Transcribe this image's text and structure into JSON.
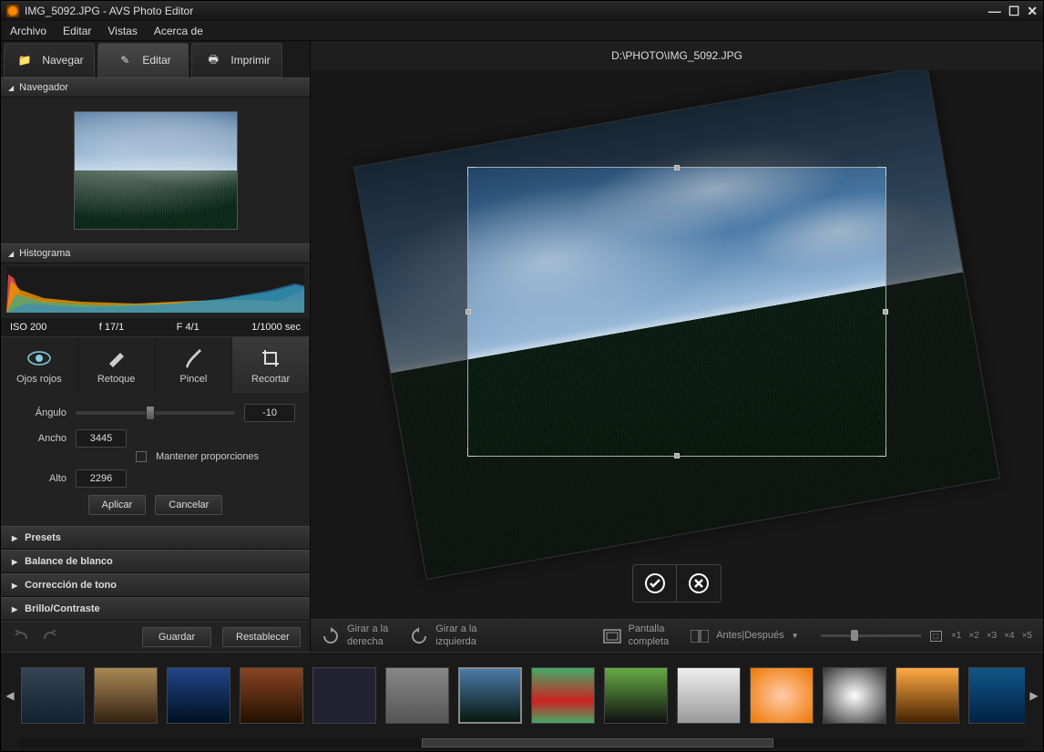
{
  "window": {
    "title": "IMG_5092.JPG  -  AVS Photo Editor"
  },
  "menubar": {
    "file": "Archivo",
    "edit": "Editar",
    "views": "Vistas",
    "about": "Acerca de"
  },
  "tabs": {
    "browse": "Navegar",
    "edit": "Editar",
    "print": "Imprimir"
  },
  "panels": {
    "navigator": "Navegador",
    "histogram": "Histograma"
  },
  "exif": {
    "iso": "ISO 200",
    "focal": "f 17/1",
    "aperture": "F 4/1",
    "shutter": "1/1000 sec"
  },
  "tools": {
    "redeye": "Ojos rojos",
    "retouch": "Retoque",
    "brush": "Pincel",
    "crop": "Recortar"
  },
  "crop": {
    "angle_label": "Ángulo",
    "angle_value": "-10",
    "width_label": "Ancho",
    "width_value": "3445",
    "height_label": "Alto",
    "height_value": "2296",
    "keep_ratio": "Mantener proporciones",
    "apply": "Aplicar",
    "cancel": "Cancelar"
  },
  "accordion": {
    "presets": "Presets",
    "white_balance": "Balance de blanco",
    "tone": "Corrección de tono",
    "brightness": "Brillo/Contraste"
  },
  "sidebar_actions": {
    "save": "Guardar",
    "reset": "Restablecer"
  },
  "filepath": "D:\\PHOTO\\IMG_5092.JPG",
  "main_toolbar": {
    "rotate_right": "Girar a la\nderecha",
    "rotate_left": "Girar a la\nizquierda",
    "fullscreen": "Pantalla\ncompleta",
    "before_after": "Antes|Después",
    "zoom_stops": [
      "×1",
      "×2",
      "×3",
      "×4",
      "×5"
    ],
    "fit_icon": "⬜"
  },
  "thumbs_count": 15
}
